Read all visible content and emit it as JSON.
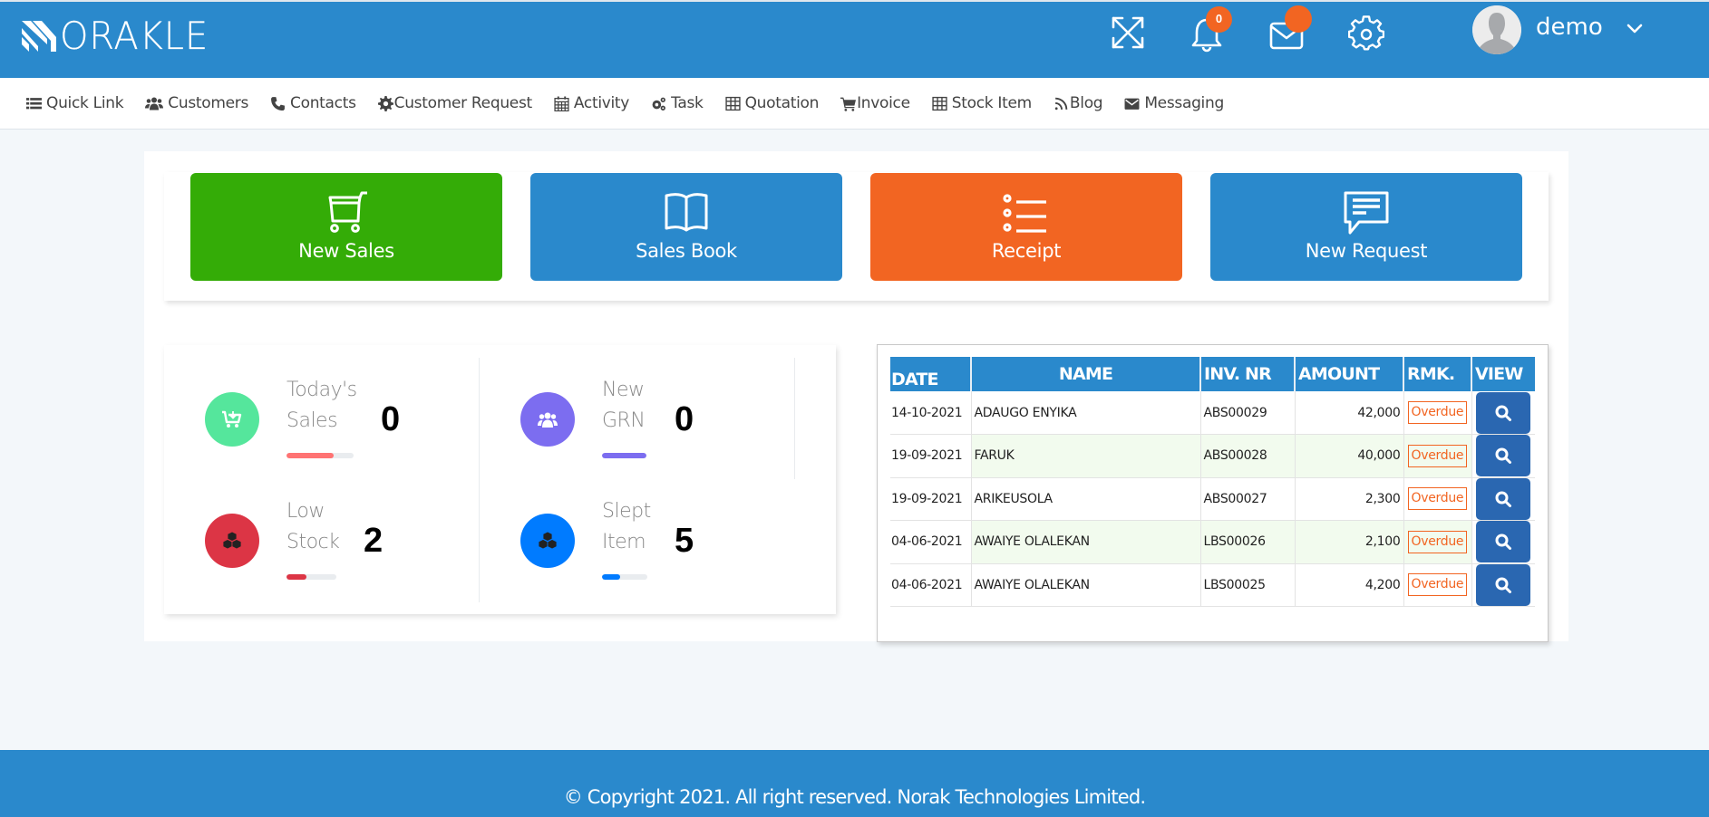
{
  "header": {
    "brand": "ORAKLE",
    "icons": {
      "fullscreen": "expand-icon",
      "notifications": "bell-icon",
      "messages": "mail-icon",
      "settings": "gear-icon",
      "user_menu": "chevron-down-icon"
    },
    "notification_count": "0",
    "message_count": "",
    "user": {
      "name": "demo"
    }
  },
  "nav": {
    "items": [
      {
        "label": "Quick Link",
        "icon": "list-icon"
      },
      {
        "label": "Customers",
        "icon": "users-icon"
      },
      {
        "label": "Contacts",
        "icon": "phone-icon"
      },
      {
        "label": "Customer Request",
        "icon": "cog-icon"
      },
      {
        "label": "Activity",
        "icon": "calendar-icon"
      },
      {
        "label": "Task",
        "icon": "cogs-icon"
      },
      {
        "label": "Quotation",
        "icon": "table-icon"
      },
      {
        "label": "Invoice",
        "icon": "cart-icon"
      },
      {
        "label": "Stock Item",
        "icon": "table-icon"
      },
      {
        "label": "Blog",
        "icon": "rss-icon"
      },
      {
        "label": "Messaging",
        "icon": "envelope-icon"
      }
    ]
  },
  "quick_actions": [
    {
      "label": "New Sales",
      "icon": "shopping-cart-icon",
      "color": "#34ac07"
    },
    {
      "label": "Sales Book",
      "icon": "open-book-icon",
      "color": "#2a89cc"
    },
    {
      "label": "Receipt",
      "icon": "list-icon",
      "color": "#f26522"
    },
    {
      "label": "New Request",
      "icon": "chat-bubble-icon",
      "color": "#2a89cc"
    }
  ],
  "stats": [
    {
      "label_line1": "Today's",
      "label_line2": "Sales",
      "value": "0",
      "color": "#55e69c",
      "bar_color": "#ff7373",
      "progress_percent": 70,
      "icon": "cart-download-icon"
    },
    {
      "label_line1": "New",
      "label_line2": "GRN",
      "value": "0",
      "color": "#7c6df0",
      "bar_color": "#7c6df0",
      "progress_percent": 100,
      "icon": "users-icon"
    },
    {
      "label_line1": "Low",
      "label_line2": "Stock",
      "value": "2",
      "color": "#dc3545",
      "bar_color": "#dc3545",
      "progress_percent": 40,
      "icon": "cubes-icon"
    },
    {
      "label_line1": "Slept",
      "label_line2": "Item",
      "value": "5",
      "color": "#007bff",
      "bar_color": "#007bff",
      "progress_percent": 40,
      "icon": "cubes-icon"
    }
  ],
  "invoice_table": {
    "columns": [
      "DATE",
      "NAME",
      "INV. NR",
      "AMOUNT",
      "RMK.",
      "VIEW"
    ],
    "rows": [
      {
        "date": "14-10-2021",
        "name": "ADAUGO ENYIKA",
        "inv_nr": "ABS00029",
        "amount": "42,000",
        "remark": "Overdue"
      },
      {
        "date": "19-09-2021",
        "name": "FARUK",
        "inv_nr": "ABS00028",
        "amount": "40,000",
        "remark": "Overdue"
      },
      {
        "date": "19-09-2021",
        "name": "ARIKEUSOLA",
        "inv_nr": "ABS00027",
        "amount": "2,300",
        "remark": "Overdue"
      },
      {
        "date": "04-06-2021",
        "name": "AWAIYE OLALEKAN",
        "inv_nr": "LBS00026",
        "amount": "2,100",
        "remark": "Overdue"
      },
      {
        "date": "04-06-2021",
        "name": "AWAIYE OLALEKAN",
        "inv_nr": "LBS00025",
        "amount": "4,200",
        "remark": "Overdue"
      }
    ],
    "view_icon": "search-icon"
  },
  "footer": {
    "text": "© Copyright 2021. All right reserved. Norak Technologies Limited."
  },
  "colors": {
    "primary": "#2a89cc",
    "accent": "#f26522",
    "success": "#34ac07",
    "view_button": "#2a67b1"
  }
}
